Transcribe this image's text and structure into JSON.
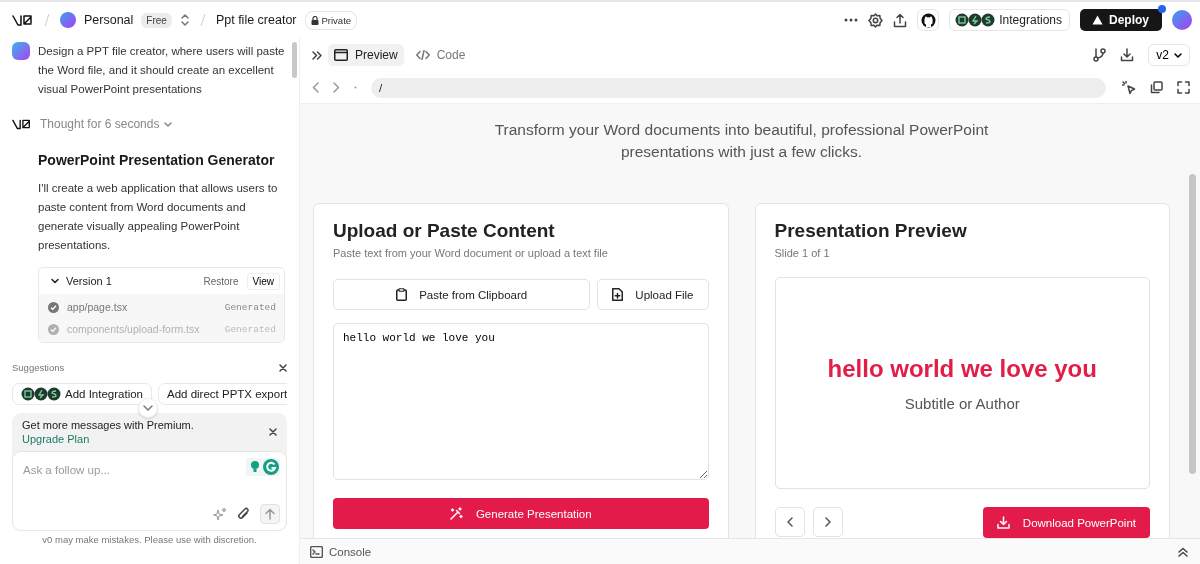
{
  "header": {
    "workspace": {
      "name": "Personal",
      "plan": "Free"
    },
    "project": {
      "name": "Ppt file creator",
      "visibility": "Private"
    },
    "integrations": "Integrations",
    "deploy": "Deploy",
    "deploy_notification": true
  },
  "chat": {
    "prompt": "Design a PPT file creator, where users will paste the Word file, and it should create an excellent visual PowerPoint presentations",
    "thought": "Thought for 6 seconds",
    "heading": "PowerPoint Presentation Generator",
    "body": "I'll create a web application that allows users to paste content from Word documents and generate visually appealing PowerPoint presentations.",
    "version": {
      "title": "Version 1",
      "expanded": true,
      "restore": "Restore",
      "view": "View",
      "files": [
        {
          "path": "app/page.tsx",
          "status": "Generated",
          "disabled": false
        },
        {
          "path": "components/upload-form.tsx",
          "status": "Generated",
          "disabled": true
        }
      ]
    },
    "suggestions": {
      "title": "Suggestions",
      "items": [
        {
          "label": "Add Integration",
          "kind": "integration"
        },
        {
          "label": "Add direct PPTX export",
          "kind": "text"
        }
      ]
    },
    "upsell": {
      "text": "Get more messages with Premium.",
      "link": "Upgrade Plan"
    },
    "composer": {
      "placeholder": "Ask a follow up..."
    },
    "disclaimer": "v0 may make mistakes. Please use with discretion."
  },
  "preview": {
    "tabs": [
      {
        "label": "Preview",
        "kind": "preview",
        "selected": true
      },
      {
        "label": "Code",
        "kind": "code",
        "selected": false
      }
    ],
    "version": "v2",
    "url": "/",
    "app": {
      "subtitle": "Transform your Word documents into beautiful, professional PowerPoint presentations with just a few clicks.",
      "upload": {
        "title": "Upload or Paste Content",
        "description": "Paste text from your Word document or upload a text file",
        "paste": "Paste from Clipboard",
        "file": "Upload File",
        "content": "hello world we love you",
        "generate": "Generate Presentation"
      },
      "result": {
        "title": "Presentation Preview",
        "counter": "Slide 1 of 1",
        "slide_title": "hello world we love you",
        "slide_subtitle": "Subtitle or Author",
        "download": "Download PowerPoint"
      }
    },
    "console": "Console"
  }
}
